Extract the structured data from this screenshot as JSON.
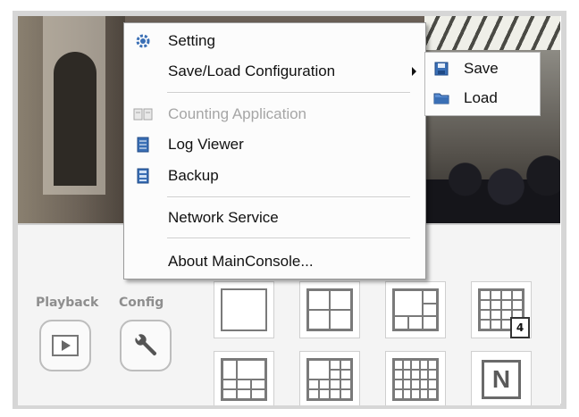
{
  "menu": {
    "items": [
      {
        "label": "Setting",
        "icon": "gear-icon"
      },
      {
        "label": "Save/Load Configuration",
        "icon": ""
      },
      {
        "label": "Counting Application",
        "icon": "counting-icon",
        "disabled": true
      },
      {
        "label": "Log Viewer",
        "icon": "log-viewer-icon"
      },
      {
        "label": "Backup",
        "icon": "backup-icon"
      },
      {
        "label": "Network Service",
        "icon": ""
      },
      {
        "label": "About MainConsole...",
        "icon": ""
      }
    ]
  },
  "submenu": {
    "items": [
      {
        "label": "Save",
        "icon": "floppy-disk-icon"
      },
      {
        "label": "Load",
        "icon": "folder-icon"
      }
    ]
  },
  "panel": {
    "playback_label": "Playback",
    "config_label": "Config",
    "layout_badge": "4",
    "n_label": "N"
  },
  "colors": {
    "menu_icon_blue": "#3a6fb5",
    "disabled_text": "#a6a6a6",
    "panel_text": "#8e8e8e"
  }
}
